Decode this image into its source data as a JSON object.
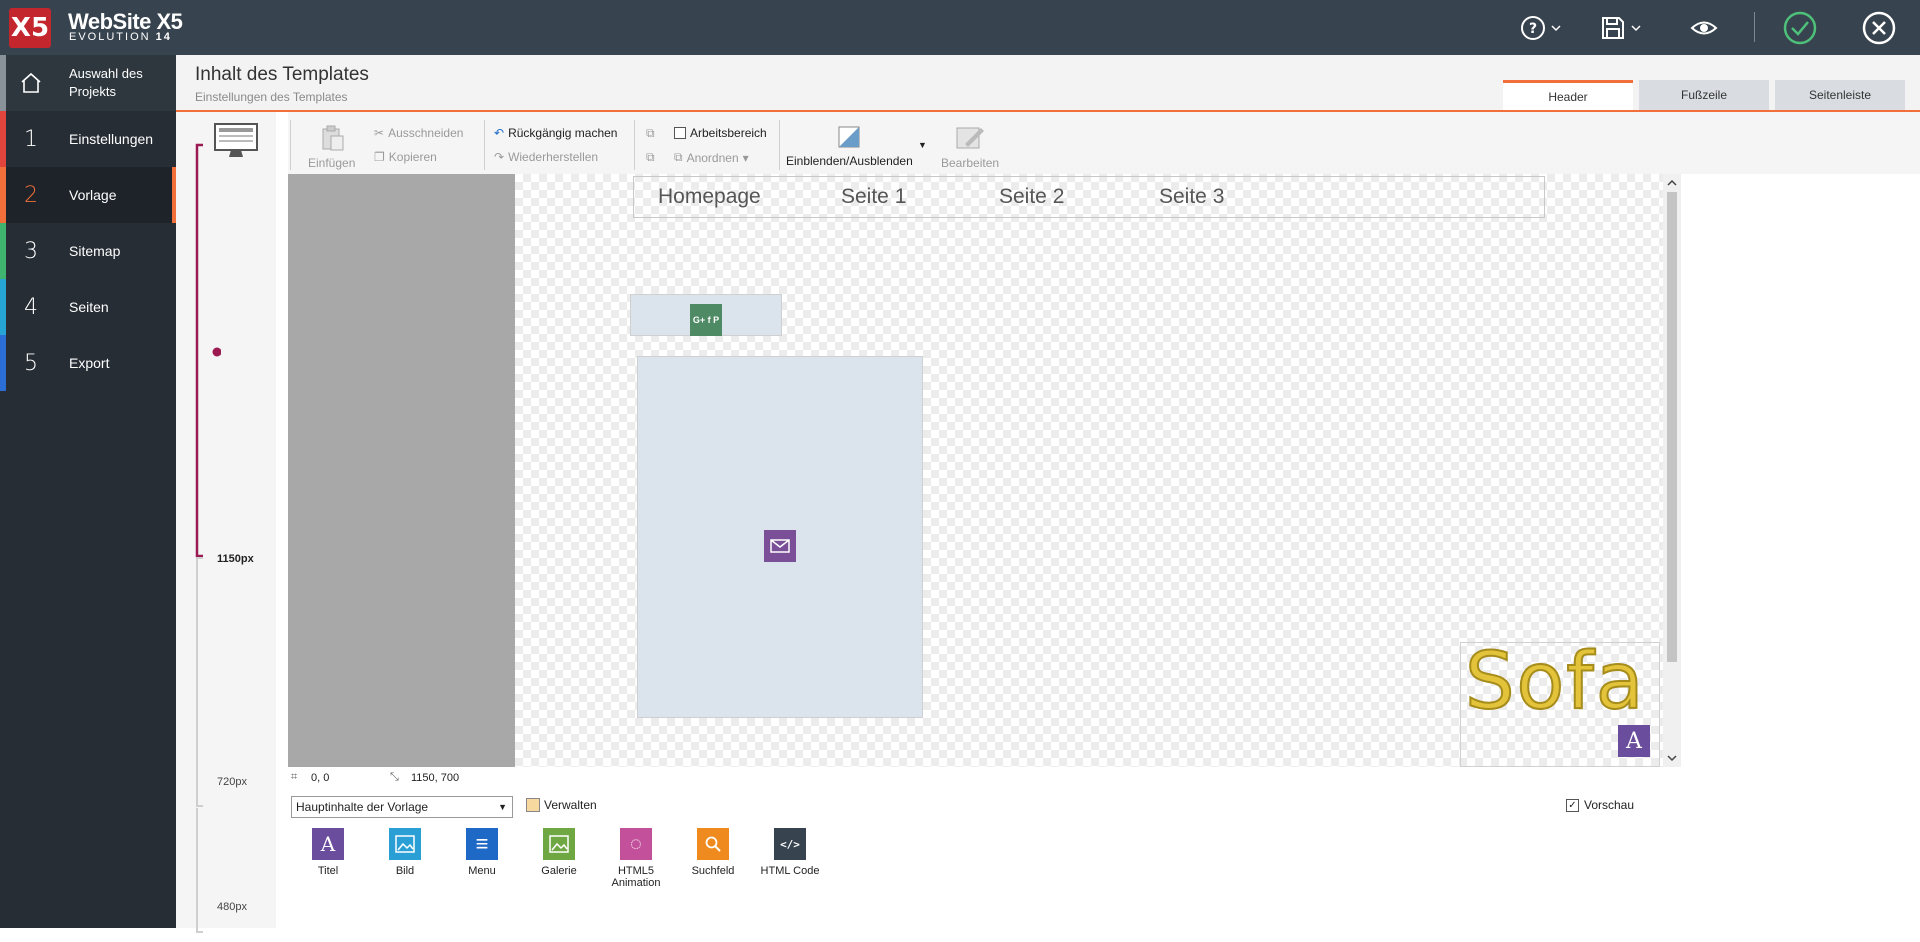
{
  "app": {
    "name": "WebSite X5",
    "edition": "EVOLUTION",
    "version": "14",
    "logo_letters": "X5"
  },
  "topbar": {
    "icons": [
      "help-icon",
      "save-icon",
      "preview-eye-icon",
      "confirm-check-icon",
      "close-icon"
    ]
  },
  "sidebar": {
    "home_label": "Auswahl des Projekts",
    "steps": [
      {
        "num": "1",
        "label": "Einstellungen",
        "color": "#e1443d"
      },
      {
        "num": "2",
        "label": "Vorlage",
        "color": "#f36f3a"
      },
      {
        "num": "3",
        "label": "Sitemap",
        "color": "#3fb56f"
      },
      {
        "num": "4",
        "label": "Seiten",
        "color": "#26a4d3"
      },
      {
        "num": "5",
        "label": "Export",
        "color": "#2b6fd6"
      }
    ]
  },
  "header": {
    "title": "Inhalt des Templates",
    "subtitle": "Einstellungen des Templates"
  },
  "tabs": [
    {
      "label": "Header",
      "active": true
    },
    {
      "label": "Fußzeile",
      "active": false
    },
    {
      "label": "Seitenleiste",
      "active": false
    }
  ],
  "ruler": {
    "labels": [
      "1150px",
      "720px",
      "480px"
    ]
  },
  "ribbon": {
    "paste": "Einfügen",
    "cut": "Ausschneiden",
    "copy": "Kopieren",
    "undo": "Rückgängig machen",
    "redo": "Wiederherstellen",
    "workspace": "Arbeitsbereich",
    "arrange": "Anordnen",
    "show_hide": "Einblenden/Ausblenden",
    "edit": "Bearbeiten"
  },
  "canvas": {
    "menu_items": [
      "Homepage",
      "Seite 1",
      "Seite 2",
      "Seite 3"
    ],
    "logo_text": "Sofa",
    "social_icons": "G+ f P",
    "colors": {
      "social": "#4e8a64",
      "mail": "#7a4f97",
      "title_badge": "#6b4d9e",
      "logo_text": "#e3c33a"
    }
  },
  "status": {
    "position": "0, 0",
    "size": "1150, 700"
  },
  "bottom": {
    "dropdown_value": "Hauptinhalte der Vorlage",
    "manage": "Verwalten",
    "preview": "Vorschau",
    "widgets": [
      {
        "label": "Titel",
        "icon": "title-icon",
        "color": "#6b4d9e",
        "glyph": "A"
      },
      {
        "label": "Bild",
        "icon": "image-icon",
        "color": "#2a9fd6",
        "glyph": "▣"
      },
      {
        "label": "Menu",
        "icon": "menu-icon",
        "color": "#1f69c6",
        "glyph": "≡"
      },
      {
        "label": "Galerie",
        "icon": "gallery-icon",
        "color": "#6fa843",
        "glyph": "▣"
      },
      {
        "label": "HTML5 Animation",
        "icon": "animation-icon",
        "color": "#c2509a",
        "glyph": "◌"
      },
      {
        "label": "Suchfeld",
        "icon": "search-icon",
        "color": "#ef8a1e",
        "glyph": "⚲"
      },
      {
        "label": "HTML Code",
        "icon": "code-icon",
        "color": "#37434e",
        "glyph": "</>"
      }
    ]
  }
}
